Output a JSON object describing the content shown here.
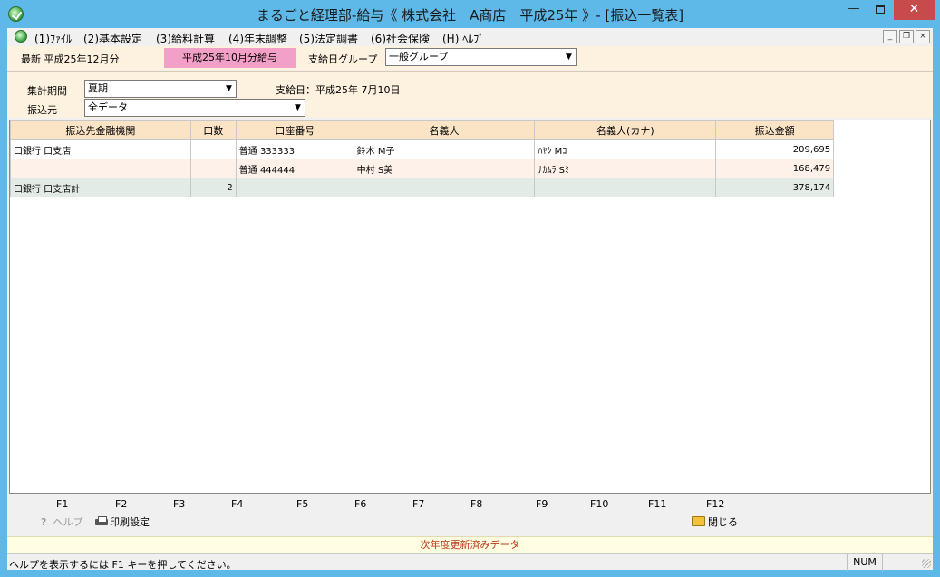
{
  "window": {
    "title": "まるごと経理部-給与《 株式会社　A商店　平成25年 》- [振込一覧表]",
    "min_icon": "minimize-icon",
    "max_icon": "maximize-icon",
    "close_label": "✕"
  },
  "menu": {
    "items": [
      "(1)ﾌｧｲﾙ",
      "(2)基本設定",
      "(3)給料計算",
      "(4)年末調整",
      "(5)法定調書",
      "(6)社会保険",
      "(H) ﾍﾙﾌﾟ"
    ]
  },
  "mdi": {
    "min": "_",
    "restore": "❐",
    "close": "×"
  },
  "topbar": {
    "latest": "最新 平成25年12月分",
    "pay_badge": "平成25年10月分給与",
    "group_label": "支給日グループ",
    "group_value": "一般グループ"
  },
  "filters": {
    "period_label": "集計期間",
    "period_value": "夏期",
    "payday": "支給日：平成25年 7月10日",
    "source_label": "振込元",
    "source_value": "全データ"
  },
  "table": {
    "headers": [
      "振込先金融機関",
      "口数",
      "口座番号",
      "名義人",
      "名義人(カナ)",
      "振込金額"
    ],
    "rows": [
      {
        "bank": "口銀行 口支店",
        "count": "",
        "account": "普通 333333",
        "name": "鈴木 M子",
        "kana": "ﾊﾔｼ Mｺ",
        "amount": "209,695"
      },
      {
        "bank": "",
        "count": "",
        "account": "普通 444444",
        "name": "中村 S美",
        "kana": "ﾅｶﾑﾗ Sﾐ",
        "amount": "168,479"
      },
      {
        "bank": "口銀行 口支店計",
        "count": "2",
        "account": "",
        "name": "",
        "kana": "",
        "amount": "378,174"
      }
    ]
  },
  "fkeys": {
    "labels": [
      "F1",
      "F2",
      "F3",
      "F4",
      "F5",
      "F6",
      "F7",
      "F8",
      "F9",
      "F10",
      "F11",
      "F12"
    ],
    "help": "ヘルプ",
    "print": "印刷設定",
    "close": "閉じる"
  },
  "notice": "次年度更新済みデータ",
  "status": {
    "text": "ヘルプを表示するには F1 キーを押してください。",
    "num": "NUM"
  }
}
